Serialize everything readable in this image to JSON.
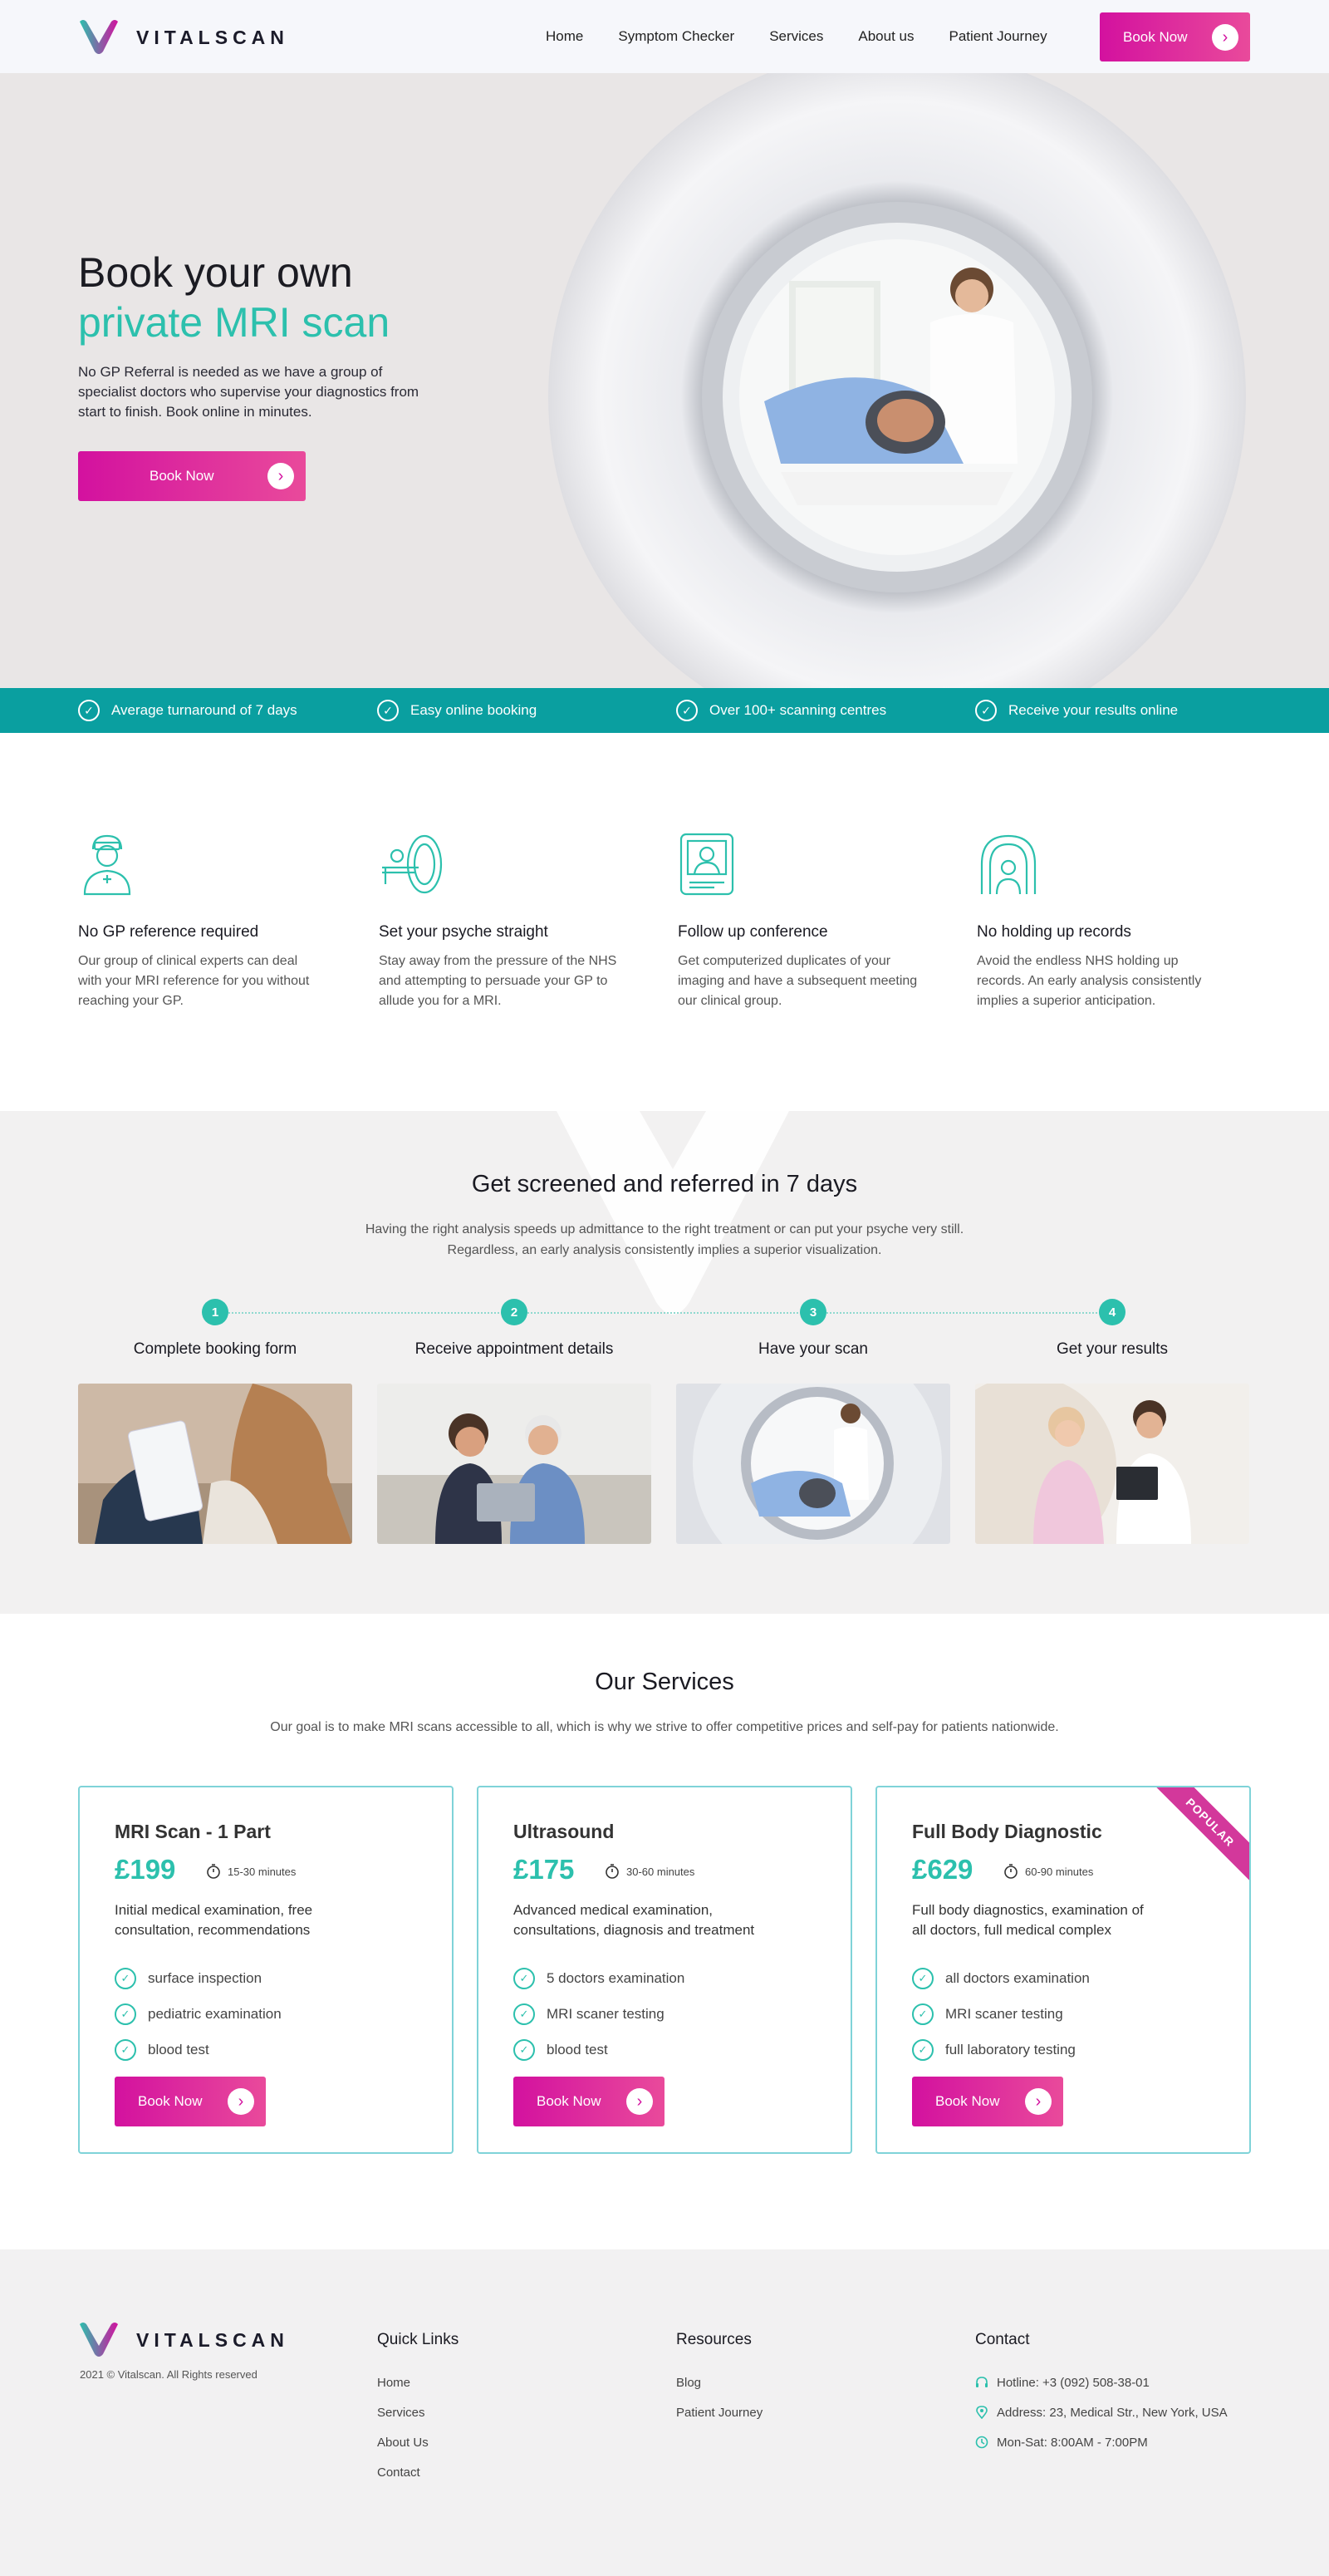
{
  "brand": {
    "name": "VITALSCAN",
    "accent": "#2cc0ad",
    "cta": "#d3119f",
    "teal_bar": "#0a9fa0"
  },
  "nav": {
    "items": [
      "Home",
      "Symptom Checker",
      "Services",
      "About us",
      "Patient Journey"
    ],
    "cta": "Book Now"
  },
  "hero": {
    "title_line1": "Book your own",
    "title_line2": "private MRI scan",
    "text": "No GP Referral is needed as we have a group of specialist doctors who supervise your diagnostics from start to finish. Book online in minutes.",
    "cta": "Book Now"
  },
  "highlights": [
    "Average turnaround of 7 days",
    "Easy online booking",
    "Over 100+ scanning centres",
    "Receive your results online"
  ],
  "features": [
    {
      "icon": "nurse-icon",
      "title": "No GP reference required",
      "text": "Our group of clinical experts can deal with your MRI reference for you without reaching your GP."
    },
    {
      "icon": "mri-machine-icon",
      "title": "Set your psyche straight",
      "text": "Stay away from the pressure of the NHS and attempting to persuade your GP to allude you for a MRI."
    },
    {
      "icon": "tablet-doctor-icon",
      "title": "Follow up conference",
      "text": "Get computerized duplicates of your imaging and have a subsequent meeting our clinical group."
    },
    {
      "icon": "scanner-patient-icon",
      "title": "No holding up records",
      "text": "Avoid the endless NHS holding up records. An early analysis consistently implies a superior anticipation."
    }
  ],
  "steps": {
    "title": "Get screened and referred in 7 days",
    "subtitle_line1": "Having the right analysis speeds up admittance to the right treatment or can put your psyche very still.",
    "subtitle_line2": "Regardless, an early analysis consistently implies a superior visualization.",
    "items": [
      {
        "num": "1",
        "label": "Complete booking form"
      },
      {
        "num": "2",
        "label": "Receive appointment details"
      },
      {
        "num": "3",
        "label": "Have your scan"
      },
      {
        "num": "4",
        "label": "Get your results"
      }
    ]
  },
  "services": {
    "title": "Our Services",
    "subtitle": "Our goal is to make MRI scans accessible to all, which is why we strive to offer competitive prices and self-pay for patients nationwide.",
    "cards": [
      {
        "title": "MRI Scan - 1 Part",
        "price": "£199",
        "duration": "15-30 minutes",
        "desc": "Initial medical examination, free consultation, recommendations",
        "items": [
          "surface inspection",
          "pediatric examination",
          "blood test"
        ],
        "cta": "Book Now"
      },
      {
        "title": "Ultrasound",
        "price": "£175",
        "duration": "30-60 minutes",
        "desc": "Advanced medical examination, consultations, diagnosis and treatment",
        "items": [
          "5 doctors examination",
          "MRI scaner testing",
          "blood test"
        ],
        "cta": "Book Now"
      },
      {
        "title": "Full Body Diagnostic",
        "price": "£629",
        "duration": "60-90 minutes",
        "desc": "Full body diagnostics, examination of all doctors, full medical complex",
        "items": [
          "all doctors examination",
          "MRI scaner testing",
          "full laboratory testing"
        ],
        "cta": "Book Now",
        "badge": "POPULAR"
      }
    ]
  },
  "footer": {
    "copyright": "2021 © Vitalscan. All Rights reserved",
    "quick_links": {
      "title": "Quick Links",
      "items": [
        "Home",
        "Services",
        "About Us",
        "Contact"
      ]
    },
    "resources": {
      "title": "Resources",
      "items": [
        "Blog",
        "Patient Journey"
      ]
    },
    "contact": {
      "title": "Contact",
      "hotline": "Hotline: +3 (092) 508-38-01",
      "address": "Address: 23, Medical Str., New York, USA",
      "hours": "Mon-Sat: 8:00AM - 7:00PM"
    }
  }
}
